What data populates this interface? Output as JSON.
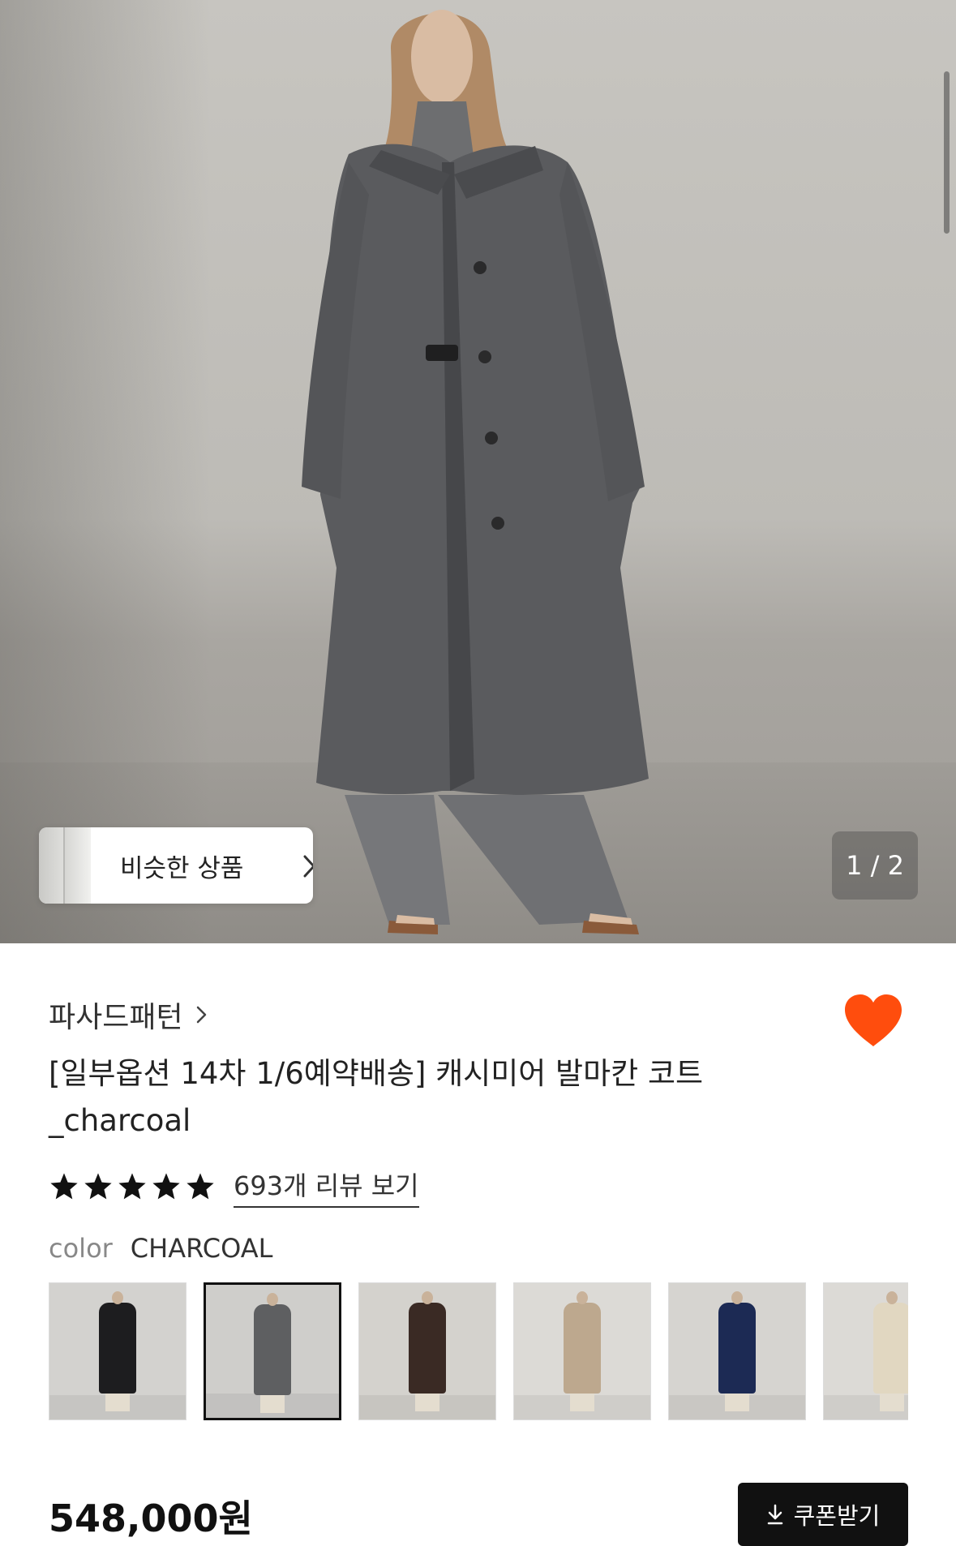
{
  "hero": {
    "image_alt": "",
    "similar_label": "비슷한 상품",
    "pager_text": "1 / 2"
  },
  "product": {
    "brand": "파사드패턴",
    "title_line1": "[일부옵션 14차 1/6예약배송] 캐시미어 발마칸 코트",
    "title_line2": "_charcoal",
    "rating_stars": 5,
    "review_link": "693개 리뷰 보기",
    "color_key": "color",
    "color_value": "CHARCOAL",
    "price": "548,000원",
    "coupon_label": "쿠폰받기",
    "wishlisted": true
  },
  "swatches": [
    {
      "name": "black",
      "coat": "#1d1d1f",
      "bg": "#d3d2cf",
      "selected": false
    },
    {
      "name": "charcoal",
      "coat": "#5e5f61",
      "bg": "#cfcecb",
      "selected": true
    },
    {
      "name": "brown",
      "coat": "#3a2a24",
      "bg": "#d4d2cd",
      "selected": false
    },
    {
      "name": "beige",
      "coat": "#bda88e",
      "bg": "#dcdad6",
      "selected": false
    },
    {
      "name": "navy",
      "coat": "#1c2a54",
      "bg": "#d6d4d0",
      "selected": false
    },
    {
      "name": "cream",
      "coat": "#e1d7c1",
      "bg": "#dcdad6",
      "selected": false
    }
  ],
  "colors": {
    "heart": "#ff4d0d",
    "coupon_bg": "#111111"
  }
}
